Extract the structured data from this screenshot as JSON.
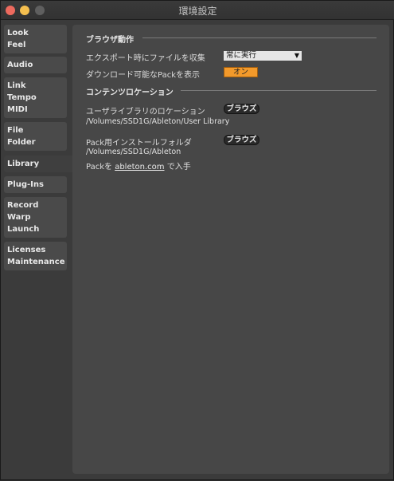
{
  "window": {
    "title": "環境設定"
  },
  "sidebar": {
    "tabs": [
      {
        "id": "look-feel",
        "lines": [
          "Look",
          "Feel"
        ]
      },
      {
        "id": "audio",
        "lines": [
          "Audio"
        ]
      },
      {
        "id": "link-tempo-midi",
        "lines": [
          "Link",
          "Tempo",
          "MIDI"
        ]
      },
      {
        "id": "file-folder",
        "lines": [
          "File",
          "Folder"
        ]
      },
      {
        "id": "library",
        "lines": [
          "Library"
        ],
        "active": true
      },
      {
        "id": "plug-ins",
        "lines": [
          "Plug-Ins"
        ]
      },
      {
        "id": "record-warp-launch",
        "lines": [
          "Record",
          "Warp",
          "Launch"
        ]
      },
      {
        "id": "licenses-maintenance",
        "lines": [
          "Licenses",
          "Maintenance"
        ]
      }
    ]
  },
  "browser_section": {
    "header": "ブラウザ動作",
    "export_label": "エクスポート時にファイルを収集",
    "export_value": "常に実行",
    "show_packs_label": "ダウンロード可能なPackを表示",
    "show_packs_value": "オン"
  },
  "content_section": {
    "header": "コンテンツロケーション",
    "user_library_label": "ユーザライブラリのロケーション",
    "user_library_browse": "ブラウズ",
    "user_library_path": "/Volumes/SSD1G/Ableton/User Library",
    "pack_folder_label": "Pack用インストールフォルダ",
    "pack_folder_browse": "ブラウズ",
    "pack_folder_path": "/Volumes/SSD1G/Ableton",
    "pack_hint_prefix": "Packを",
    "pack_hint_link": "ableton.com",
    "pack_hint_suffix": "で入手"
  },
  "colors": {
    "toggle_on": "#f39a2b",
    "panel": "#474747",
    "sidebar_tab": "#4a4a4a"
  }
}
